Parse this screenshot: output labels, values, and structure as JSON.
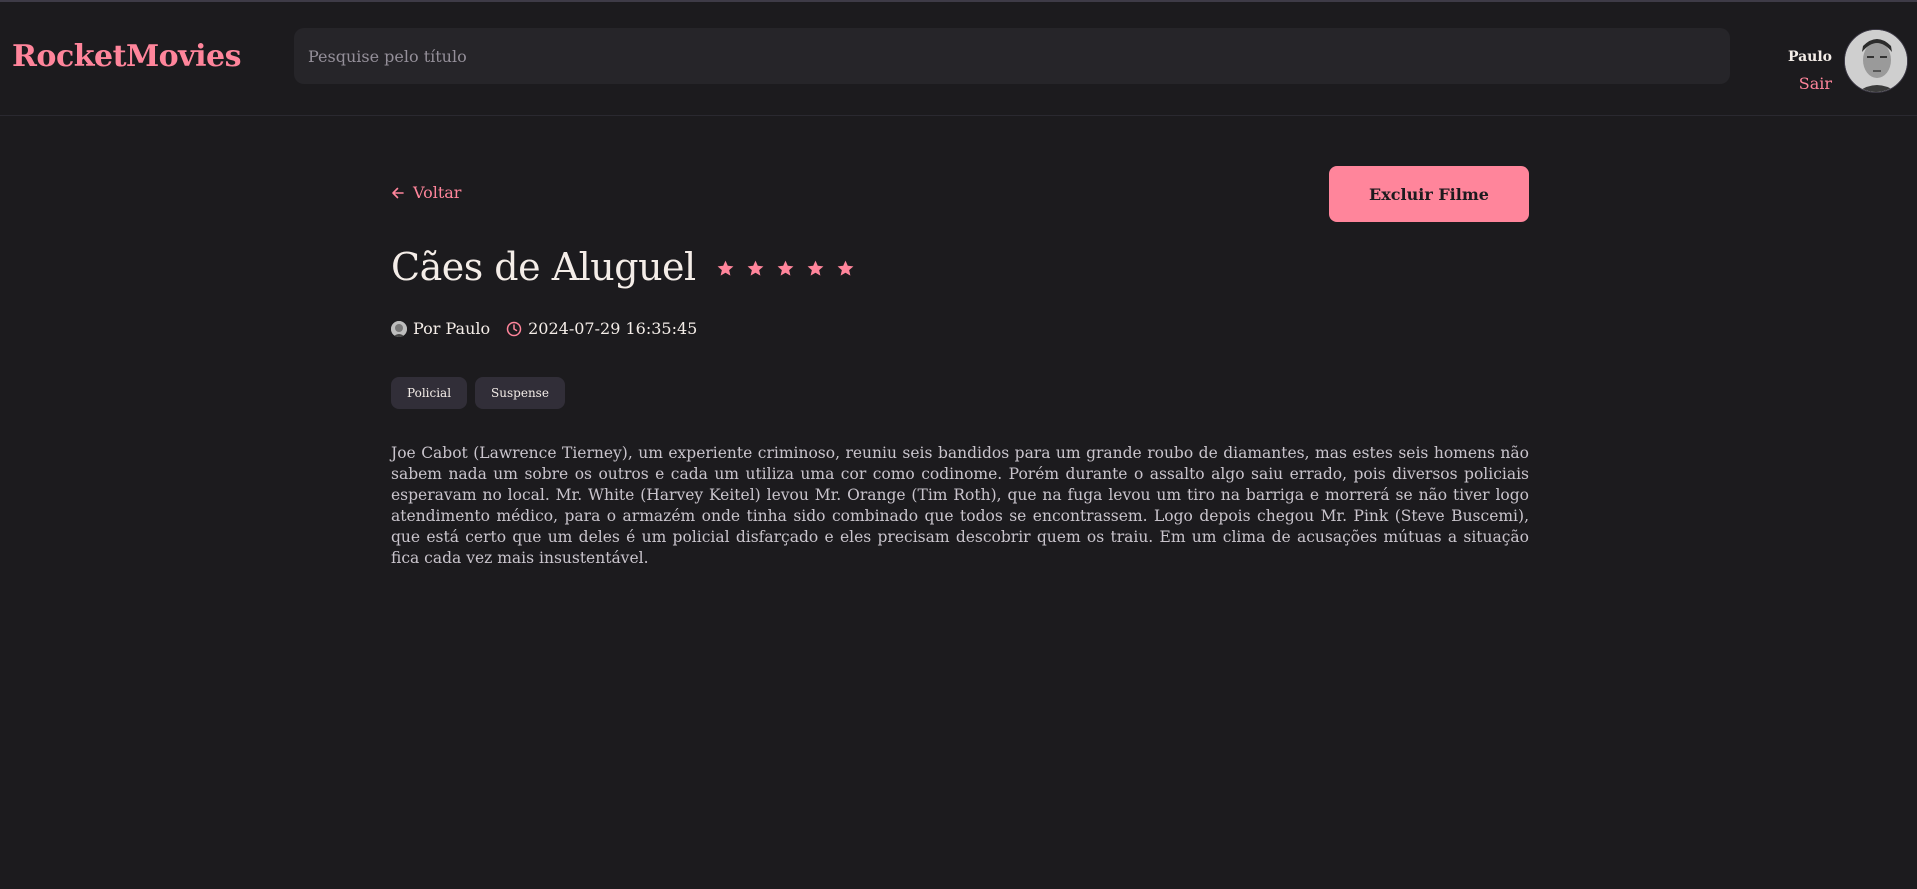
{
  "header": {
    "logo": "RocketMovies",
    "search_placeholder": "Pesquise pelo título",
    "user_name": "Paulo",
    "logout_label": "Sair"
  },
  "page": {
    "back_label": "Voltar",
    "delete_label": "Excluir Filme",
    "title": "Cães de Aluguel",
    "rating": 5,
    "rating_max": 5,
    "author": "Por Paulo",
    "datetime": "2024-07-29 16:35:45",
    "tags": [
      "Policial",
      "Suspense"
    ],
    "description": "Joe Cabot (Lawrence Tierney), um experiente criminoso, reuniu seis bandidos para um grande roubo de diamantes, mas estes seis homens não sabem nada um sobre os outros e cada um utiliza uma cor como codinome. Porém durante o assalto algo saiu errado, pois diversos policiais esperavam no local. Mr. White (Harvey Keitel) levou Mr. Orange (Tim Roth), que na fuga levou um tiro na barriga e morrerá se não tiver logo atendimento médico, para o armazém onde tinha sido combinado que todos se encontrassem. Logo depois chegou Mr. Pink (Steve Buscemi), que está certo que um deles é um policial disfarçado e eles precisam descobrir quem os traiu. Em um clima de acusações mútuas a situação fica cada vez mais insustentável."
  },
  "colors": {
    "background": "#1c1b1e",
    "accent": "#ff859b",
    "input_bg": "#262529",
    "tag_bg": "#312e38",
    "text": "#f4ede8"
  }
}
